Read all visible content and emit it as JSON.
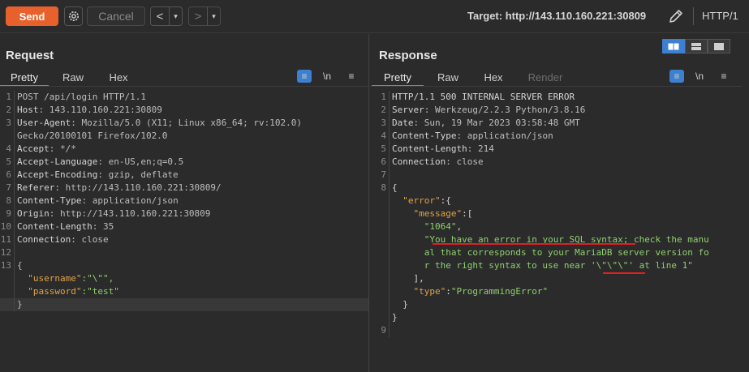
{
  "toolbar": {
    "send_label": "Send",
    "cancel_label": "Cancel",
    "back_arrow": "<",
    "forward_arrow": ">",
    "dropdown_glyph": "▾",
    "target_label": "Target: http://143.110.160.221:30809",
    "http_version": "HTTP/1"
  },
  "request": {
    "title": "Request",
    "tabs": [
      "Pretty",
      "Raw",
      "Hex"
    ],
    "wrap_icon": "≡",
    "newline_label": "\\n",
    "menu_icon": "≡",
    "lines": [
      {
        "n": "1",
        "key": "",
        "val": "POST /api/login HTTP/1.1"
      },
      {
        "n": "2",
        "key": "Host",
        "val": ": 143.110.160.221:30809"
      },
      {
        "n": "3",
        "key": "User-Agent",
        "val": ": Mozilla/5.0 (X11; Linux x86_64; rv:102.0)"
      },
      {
        "n": "",
        "key": "",
        "val": "Gecko/20100101 Firefox/102.0"
      },
      {
        "n": "4",
        "key": "Accept",
        "val": ": */*"
      },
      {
        "n": "5",
        "key": "Accept-Language",
        "val": ": en-US,en;q=0.5"
      },
      {
        "n": "6",
        "key": "Accept-Encoding",
        "val": ": gzip, deflate"
      },
      {
        "n": "7",
        "key": "Referer",
        "val": ": http://143.110.160.221:30809/"
      },
      {
        "n": "8",
        "key": "Content-Type",
        "val": ": application/json"
      },
      {
        "n": "9",
        "key": "Origin",
        "val": ": http://143.110.160.221:30809"
      },
      {
        "n": "10",
        "key": "Content-Length",
        "val": ": 35"
      },
      {
        "n": "11",
        "key": "Connection",
        "val": ": close"
      },
      {
        "n": "12",
        "key": "",
        "val": ""
      },
      {
        "n": "13",
        "key": "",
        "val": "{"
      },
      {
        "n": "",
        "key": "  \"username\"",
        "val": ":\"\\\"\","
      },
      {
        "n": "",
        "key": "  \"password\"",
        "val": ":\"test\""
      },
      {
        "n": "",
        "key": "",
        "val": "}"
      }
    ]
  },
  "response": {
    "title": "Response",
    "tabs": [
      "Pretty",
      "Raw",
      "Hex",
      "Render"
    ],
    "wrap_icon": "≡",
    "newline_label": "\\n",
    "menu_icon": "≡",
    "lines": [
      {
        "n": "1",
        "parts": [
          [
            "hk",
            "HTTP/1.1 500 INTERNAL SERVER ERROR"
          ]
        ]
      },
      {
        "n": "2",
        "parts": [
          [
            "hk",
            "Server"
          ],
          [
            "hv",
            ": Werkzeug/2.2.3 Python/3.8.16"
          ]
        ]
      },
      {
        "n": "3",
        "parts": [
          [
            "hk",
            "Date"
          ],
          [
            "hv",
            ": Sun, 19 Mar 2023 03:58:48 GMT"
          ]
        ]
      },
      {
        "n": "4",
        "parts": [
          [
            "hk",
            "Content-Type"
          ],
          [
            "hv",
            ": application/json"
          ]
        ]
      },
      {
        "n": "5",
        "parts": [
          [
            "hk",
            "Content-Length"
          ],
          [
            "hv",
            ": 214"
          ]
        ]
      },
      {
        "n": "6",
        "parts": [
          [
            "hk",
            "Connection"
          ],
          [
            "hv",
            ": close"
          ]
        ]
      },
      {
        "n": "7",
        "parts": []
      },
      {
        "n": "8",
        "parts": [
          [
            "jp",
            "{"
          ]
        ]
      },
      {
        "n": "",
        "parts": [
          [
            "jp",
            "  "
          ],
          [
            "jk",
            "\"error\""
          ],
          [
            "jp",
            ":{"
          ]
        ]
      },
      {
        "n": "",
        "parts": [
          [
            "jp",
            "    "
          ],
          [
            "jk",
            "\"message\""
          ],
          [
            "jp",
            ":["
          ]
        ]
      },
      {
        "n": "",
        "parts": [
          [
            "jp",
            "      "
          ],
          [
            "js",
            "\"1064\""
          ],
          [
            "jp",
            ","
          ]
        ]
      },
      {
        "n": "",
        "parts": [
          [
            "jp",
            "      "
          ],
          [
            "js",
            "\"You have an error in your SQL syntax; check the manu"
          ]
        ]
      },
      {
        "n": "",
        "parts": [
          [
            "js",
            "      al that corresponds to your MariaDB server version fo"
          ]
        ]
      },
      {
        "n": "",
        "parts": [
          [
            "js",
            "      r the right syntax to use near '\\\"\\\"\\\"' at line 1\""
          ]
        ]
      },
      {
        "n": "",
        "parts": [
          [
            "jp",
            "    ],"
          ]
        ]
      },
      {
        "n": "",
        "parts": [
          [
            "jp",
            "    "
          ],
          [
            "jk",
            "\"type\""
          ],
          [
            "jp",
            ":"
          ],
          [
            "js",
            "\"ProgrammingError\""
          ]
        ]
      },
      {
        "n": "",
        "parts": [
          [
            "jp",
            "  }"
          ]
        ]
      },
      {
        "n": "",
        "parts": [
          [
            "jp",
            "}"
          ]
        ]
      },
      {
        "n": "9",
        "parts": []
      }
    ]
  },
  "colors": {
    "accent": "#e8612c",
    "annotation": "#e02020",
    "wrap_toggle": "#3d7fd0"
  },
  "icons": [
    "gear-icon",
    "pencil-icon",
    "wrap-lines-icon",
    "newline-icon",
    "hamburger-menu-icon",
    "split-horizontal-icon",
    "split-vertical-icon",
    "single-pane-icon"
  ]
}
